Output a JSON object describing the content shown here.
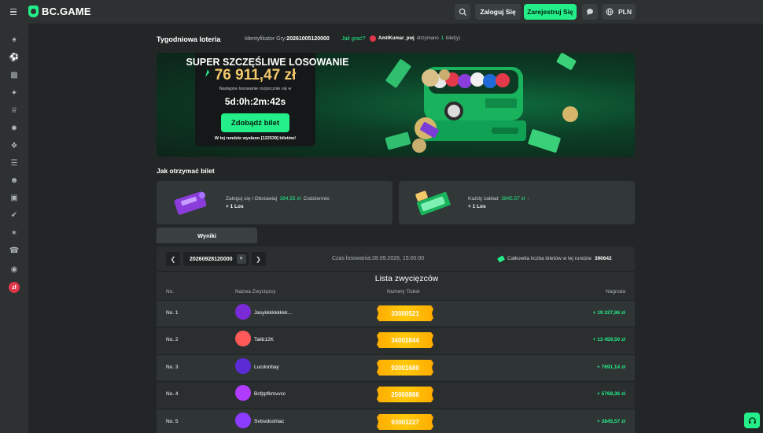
{
  "header": {
    "logo_text": "BC.GAME",
    "login_label": "Zaloguj Się",
    "register_label": "Zarejestruj Się",
    "currency": "PLN"
  },
  "sidebar": {
    "icons": [
      "casino-icon",
      "sports-icon",
      "lottery-icon",
      "promotions-icon",
      "vip-club-icon",
      "bonus-icon",
      "gift-icon",
      "leaderboard-icon",
      "affiliate-icon",
      "forum-icon",
      "provably-fair-icon",
      "sponsorship-icon",
      "support-icon",
      "language-icon",
      "flag-icon"
    ]
  },
  "page": {
    "title": "Tygodniowa loteria",
    "game_id_label": "Identyfikator Gry:",
    "game_id_value": "20261005120000",
    "how_to_play": "Jak grać?",
    "ticker": {
      "user": "AmitKumar_pwj",
      "text_before": "otrzymano",
      "count": "1",
      "text_after": "bilet(y)"
    }
  },
  "banner": {
    "title": "SUPER SZCZĘŚLIWE LOSOWANIE",
    "jackpot": "76 911,47 zł",
    "next_draw_label": "Następne losowanie rozpocznie się w",
    "countdown": "5d:0h:2m:42s",
    "cta_label": "Zdobądź bilet",
    "sent_info": "W tej rundzie wysłano [122539] biletów!"
  },
  "how_to": {
    "heading": "Jak otrzymać bilet",
    "card1": {
      "text_a": "Zaloguj się i Obstawiaj",
      "amount": "384,55 zł",
      "text_b": "Codziennie:",
      "reward": "+ 1 Los"
    },
    "card2": {
      "text_a": "Każdy zakład",
      "amount": "3845,57 zł",
      "text_b": ":",
      "reward": "+ 1 Los"
    }
  },
  "results": {
    "tab_label": "Wyniki",
    "round": "20260928120000",
    "draw_time": "Czas losowania:28.09.2026, 15:00:00",
    "total_tickets_label": "Całkowita liczba biletów w tej rundzie",
    "total_tickets": "390642",
    "list_title": "Lista zwycięzców",
    "columns": {
      "no": "No.",
      "name": "Nazwa Zwycięzcy",
      "ticket": "Numery Ticket",
      "prize": "Nagroda"
    },
    "rows": [
      {
        "no": "No. 1",
        "name": "Jasykkkkkkkkk...",
        "ticket": "33000521",
        "prize": "+ 19 227,86 zł",
        "avatar_color": "#7a2bd6"
      },
      {
        "no": "No. 2",
        "name": "Talib12K",
        "ticket": "34002844",
        "prize": "+ 13 459,50 zł",
        "avatar_color": "#ff5a5a"
      },
      {
        "no": "No. 3",
        "name": "Lucdonbay",
        "ticket": "93001680",
        "prize": "+ 7691,14 zł",
        "avatar_color": "#5b2bd6"
      },
      {
        "no": "No. 4",
        "name": "Bcfppfkmvvcc",
        "ticket": "25000886",
        "prize": "+ 5768,36 zł",
        "avatar_color": "#b13cff"
      },
      {
        "no": "No. 5",
        "name": "Svlsvdoshtac",
        "ticket": "93003227",
        "prize": "+ 3845,57 zł",
        "avatar_color": "#8b3cff"
      }
    ]
  },
  "colors": {
    "accent": "#24ee89",
    "gold": "#f3c86a",
    "ticket": "#ffb800",
    "bg": "#232626",
    "panel": "#2d3131"
  }
}
